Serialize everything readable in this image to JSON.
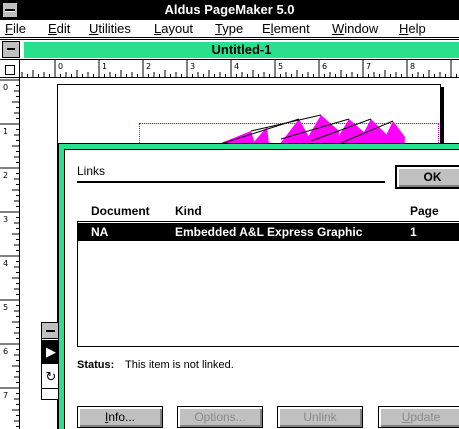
{
  "app": {
    "title": "Aldus PageMaker 5.0"
  },
  "menu": [
    {
      "label": "File",
      "accel": "F",
      "rest": "ile"
    },
    {
      "label": "Edit",
      "accel": "E",
      "rest": "dit"
    },
    {
      "label": "Utilities",
      "accel": "U",
      "rest": "tilities"
    },
    {
      "label": "Layout",
      "accel": "L",
      "rest": "ayout"
    },
    {
      "label": "Type",
      "accel": "T",
      "rest": "ype"
    },
    {
      "label": "Element",
      "accel_pre": "E",
      "accel": "l",
      "rest": "ement"
    },
    {
      "label": "Window",
      "accel": "W",
      "rest": "indow"
    },
    {
      "label": "Help",
      "accel": "H",
      "rest": "elp"
    }
  ],
  "document": {
    "title": "Untitled-1"
  },
  "ruler": {
    "horizontal": [
      "0",
      "1",
      "2",
      "3",
      "4",
      "5",
      "6",
      "7",
      "8"
    ],
    "vertical": [
      "0",
      "1",
      "2",
      "3",
      "4",
      "5",
      "6",
      "7"
    ]
  },
  "colors": {
    "accent": "#2be08c",
    "graphic": "#ff00ff",
    "guide": "#c000c0",
    "button": "#c0c0c0"
  },
  "toolbox": {
    "pointer_icon": "▶",
    "rotate_icon": "↻"
  },
  "dialog": {
    "title": "Links",
    "ok_label": "OK",
    "columns": {
      "document": "Document",
      "kind": "Kind",
      "page": "Page"
    },
    "rows": [
      {
        "document": "NA",
        "kind": "Embedded A&L Express Graphic",
        "page": "1"
      }
    ],
    "status_label": "Status:",
    "status_text": "This item is not linked.",
    "buttons": {
      "info": {
        "accel": "I",
        "rest": "nfo..."
      },
      "options": "Options...",
      "unlink": "Unlink",
      "update": {
        "accel": "U",
        "rest": "pdate"
      }
    }
  }
}
